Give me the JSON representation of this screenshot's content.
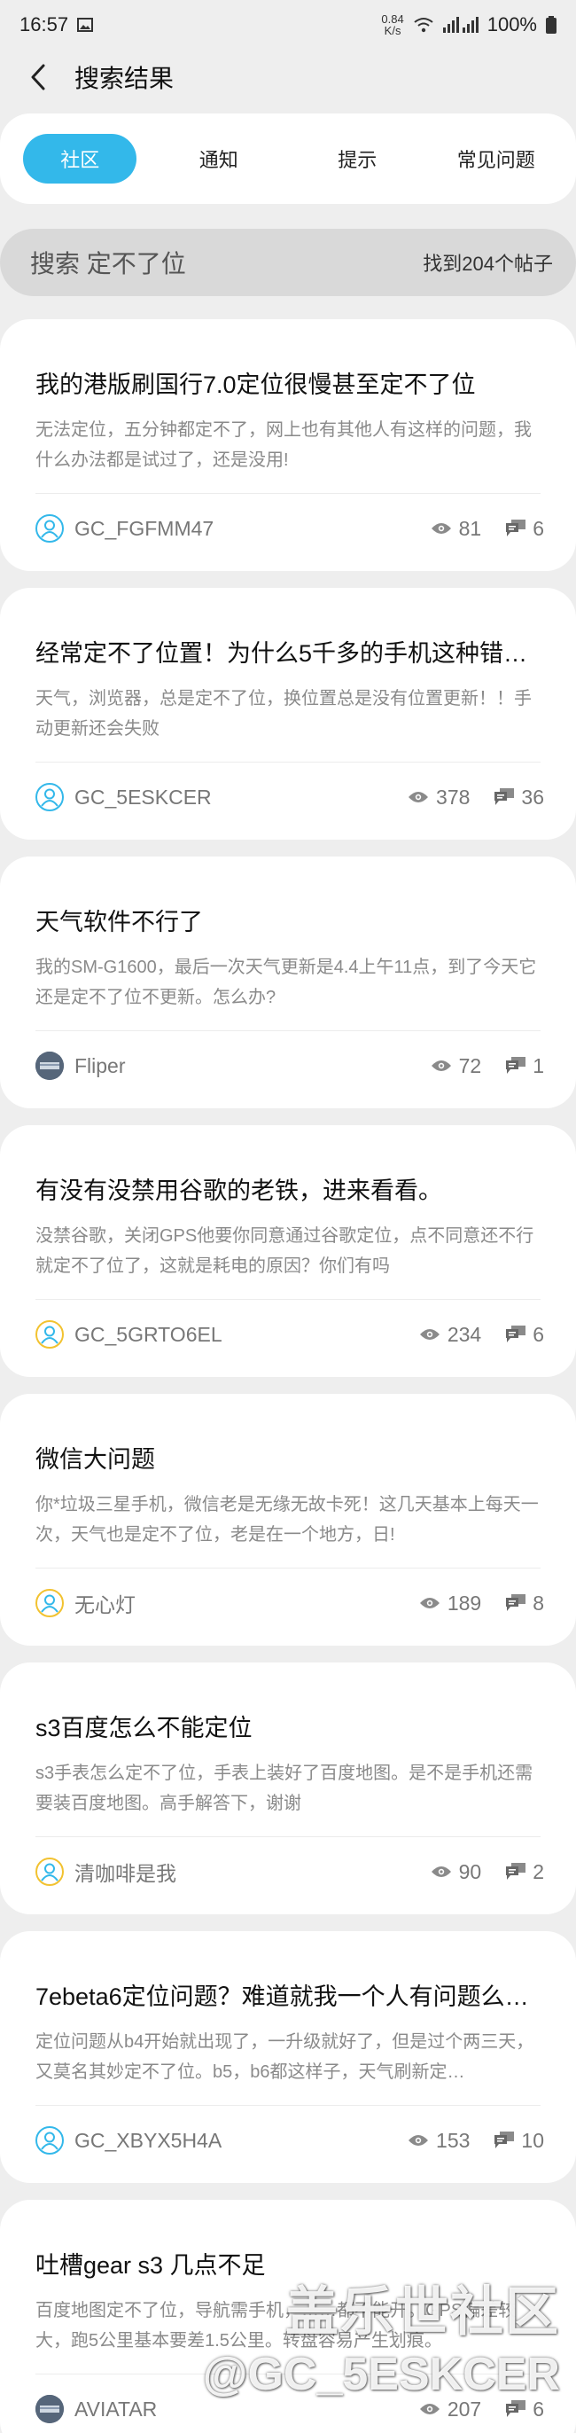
{
  "status_bar": {
    "time": "16:57",
    "net_speed_value": "0.84",
    "net_speed_unit": "K/s",
    "battery": "100%"
  },
  "app_bar": {
    "title": "搜索结果"
  },
  "tabs": [
    {
      "label": "社区",
      "active": true
    },
    {
      "label": "通知",
      "active": false
    },
    {
      "label": "提示",
      "active": false
    },
    {
      "label": "常见问题",
      "active": false
    }
  ],
  "search": {
    "query": "搜索 定不了位",
    "count": "找到204个帖子"
  },
  "posts": [
    {
      "title": "我的港版刷国行7.0定位很慢甚至定不了位",
      "excerpt": "无法定位，五分钟都定不了，网上也有其他人有这样的问题，我什么办法都是试过了，还是没用!",
      "author": "GC_FGFMM47",
      "views": "81",
      "replies": "6",
      "avatar": "user-blue"
    },
    {
      "title": "经常定不了位置！为什么5千多的手机这种错误…",
      "excerpt": "天气，浏览器，总是定不了位，换位置总是没有位置更新！！手动更新还会失败",
      "author": "GC_5ESKCER",
      "views": "378",
      "replies": "36",
      "avatar": "user-blue"
    },
    {
      "title": "天气软件不行了",
      "excerpt": "我的SM-G1600，最后一次天气更新是4.4上午11点，到了今天它还是定不了位不更新。怎么办?",
      "author": "Fliper",
      "views": "72",
      "replies": "1",
      "avatar": "user-dark"
    },
    {
      "title": "有没有没禁用谷歌的老铁，进来看看。",
      "excerpt": "没禁谷歌，关闭GPS他要你同意通过谷歌定位，点不同意还不行就定不了位了，这就是耗电的原因？你们有吗",
      "author": "GC_5GRTO6EL",
      "views": "234",
      "replies": "6",
      "avatar": "user-gold"
    },
    {
      "title": "微信大问题",
      "excerpt": "你*垃圾三星手机，微信老是无缘无故卡死！这几天基本上每天一次，天气也是定不了位，老是在一个地方，日!",
      "author": "无心灯",
      "views": "189",
      "replies": "8",
      "avatar": "user-gold"
    },
    {
      "title": "s3百度怎么不能定位",
      "excerpt": "s3手表怎么定不了位，手表上装好了百度地图。是不是手机还需要装百度地图。高手解答下，谢谢",
      "author": "清咖啡是我",
      "views": "90",
      "replies": "2",
      "avatar": "user-gold"
    },
    {
      "title": "7ebeta6定位问题？难道就我一个人有问题么…",
      "excerpt": "定位问题从b4开始就出现了，一升级就好了，但是过个两三天，又莫名其妙定不了位。b5，b6都这样子，天气刷新定…",
      "author": "GC_XBYX5H4A",
      "views": "153",
      "replies": "10",
      "avatar": "user-blue"
    },
    {
      "title": "吐槽gear s3 几点不足",
      "excerpt": "百度地图定不了位，导航需手机，……都不能开。GPS偏差较大，跑5公里基本要差1.5公里。转盘容易产生划痕。",
      "author": "AVIATAR",
      "views": "207",
      "replies": "6",
      "avatar": "user-dark"
    }
  ],
  "watermark": {
    "line1": "盖乐世社区",
    "line2": "@GC_5ESKCER"
  },
  "colors": {
    "accent": "#33b8ea",
    "background": "#eeeeee",
    "card": "#ffffff",
    "muted_text": "#8a8a8a"
  }
}
